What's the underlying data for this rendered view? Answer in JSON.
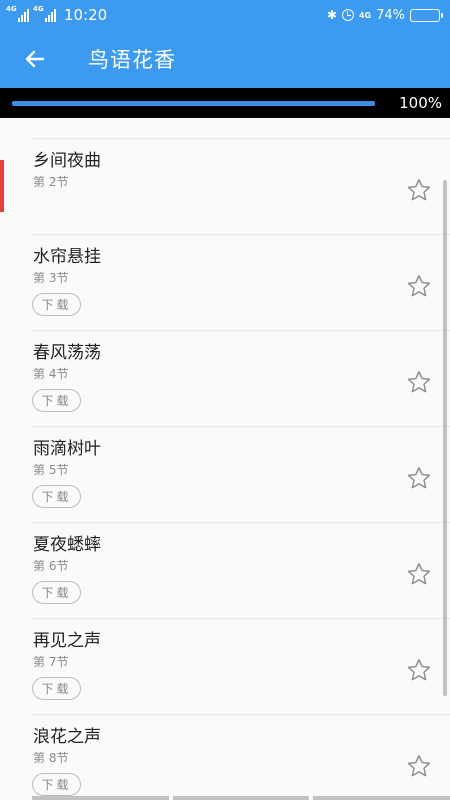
{
  "status_bar": {
    "sim1": "4G",
    "sim2": "4G",
    "time": "10:20",
    "net_badge": "4G",
    "battery_percent": "74%",
    "battery_level": 0.74
  },
  "app_bar": {
    "title": "鸟语花香"
  },
  "progress": {
    "label": "100%",
    "value": 1.0
  },
  "chapters": [
    {
      "title": "乡间夜曲",
      "subtitle": "第 2节",
      "download_label": "",
      "active": true
    },
    {
      "title": "水帘悬挂",
      "subtitle": "第 3节",
      "download_label": "下载"
    },
    {
      "title": "春风荡荡",
      "subtitle": "第 4节",
      "download_label": "下载"
    },
    {
      "title": "雨滴树叶",
      "subtitle": "第 5节",
      "download_label": "下载"
    },
    {
      "title": "夏夜蟋蟀",
      "subtitle": "第 6节",
      "download_label": "下载"
    },
    {
      "title": "再见之声",
      "subtitle": "第 7节",
      "download_label": "下载"
    },
    {
      "title": "浪花之声",
      "subtitle": "第 8节",
      "download_label": "下载"
    }
  ],
  "icons": {
    "back": "arrow-left-icon",
    "favorite": "star-outline-icon"
  },
  "colors": {
    "primary": "#3c9bf0",
    "active_marker": "#e8413a",
    "progress_fill": "#3a8ee8"
  }
}
